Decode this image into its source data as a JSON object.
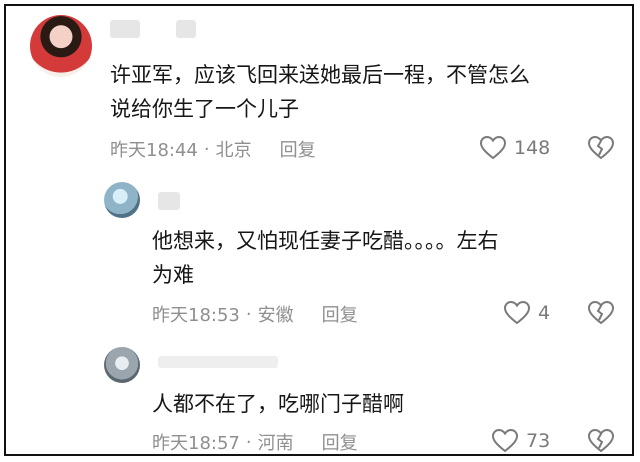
{
  "comments": [
    {
      "text_line1": "许亚军，应该飞回来送她最后一程，不管怎么",
      "text_line2": "说给你生了一个儿子",
      "time": "昨天18:44",
      "location": "北京",
      "reply": "回复",
      "likes": "148"
    },
    {
      "text_line1": "他想来，又怕现任妻子吃醋。。。。左右",
      "text_line2": "为难",
      "time": "昨天18:53",
      "location": "安徽",
      "reply": "回复",
      "likes": "4"
    },
    {
      "text_line1": "人都不在了，吃哪门子醋啊",
      "time": "昨天18:57",
      "location": "河南",
      "reply": "回复",
      "likes": "73"
    }
  ],
  "icons": [
    "heart-icon",
    "broken-heart-icon"
  ],
  "colors": {
    "text": "#161616",
    "meta": "#8f8f8f",
    "icon": "#7a7a7a"
  }
}
